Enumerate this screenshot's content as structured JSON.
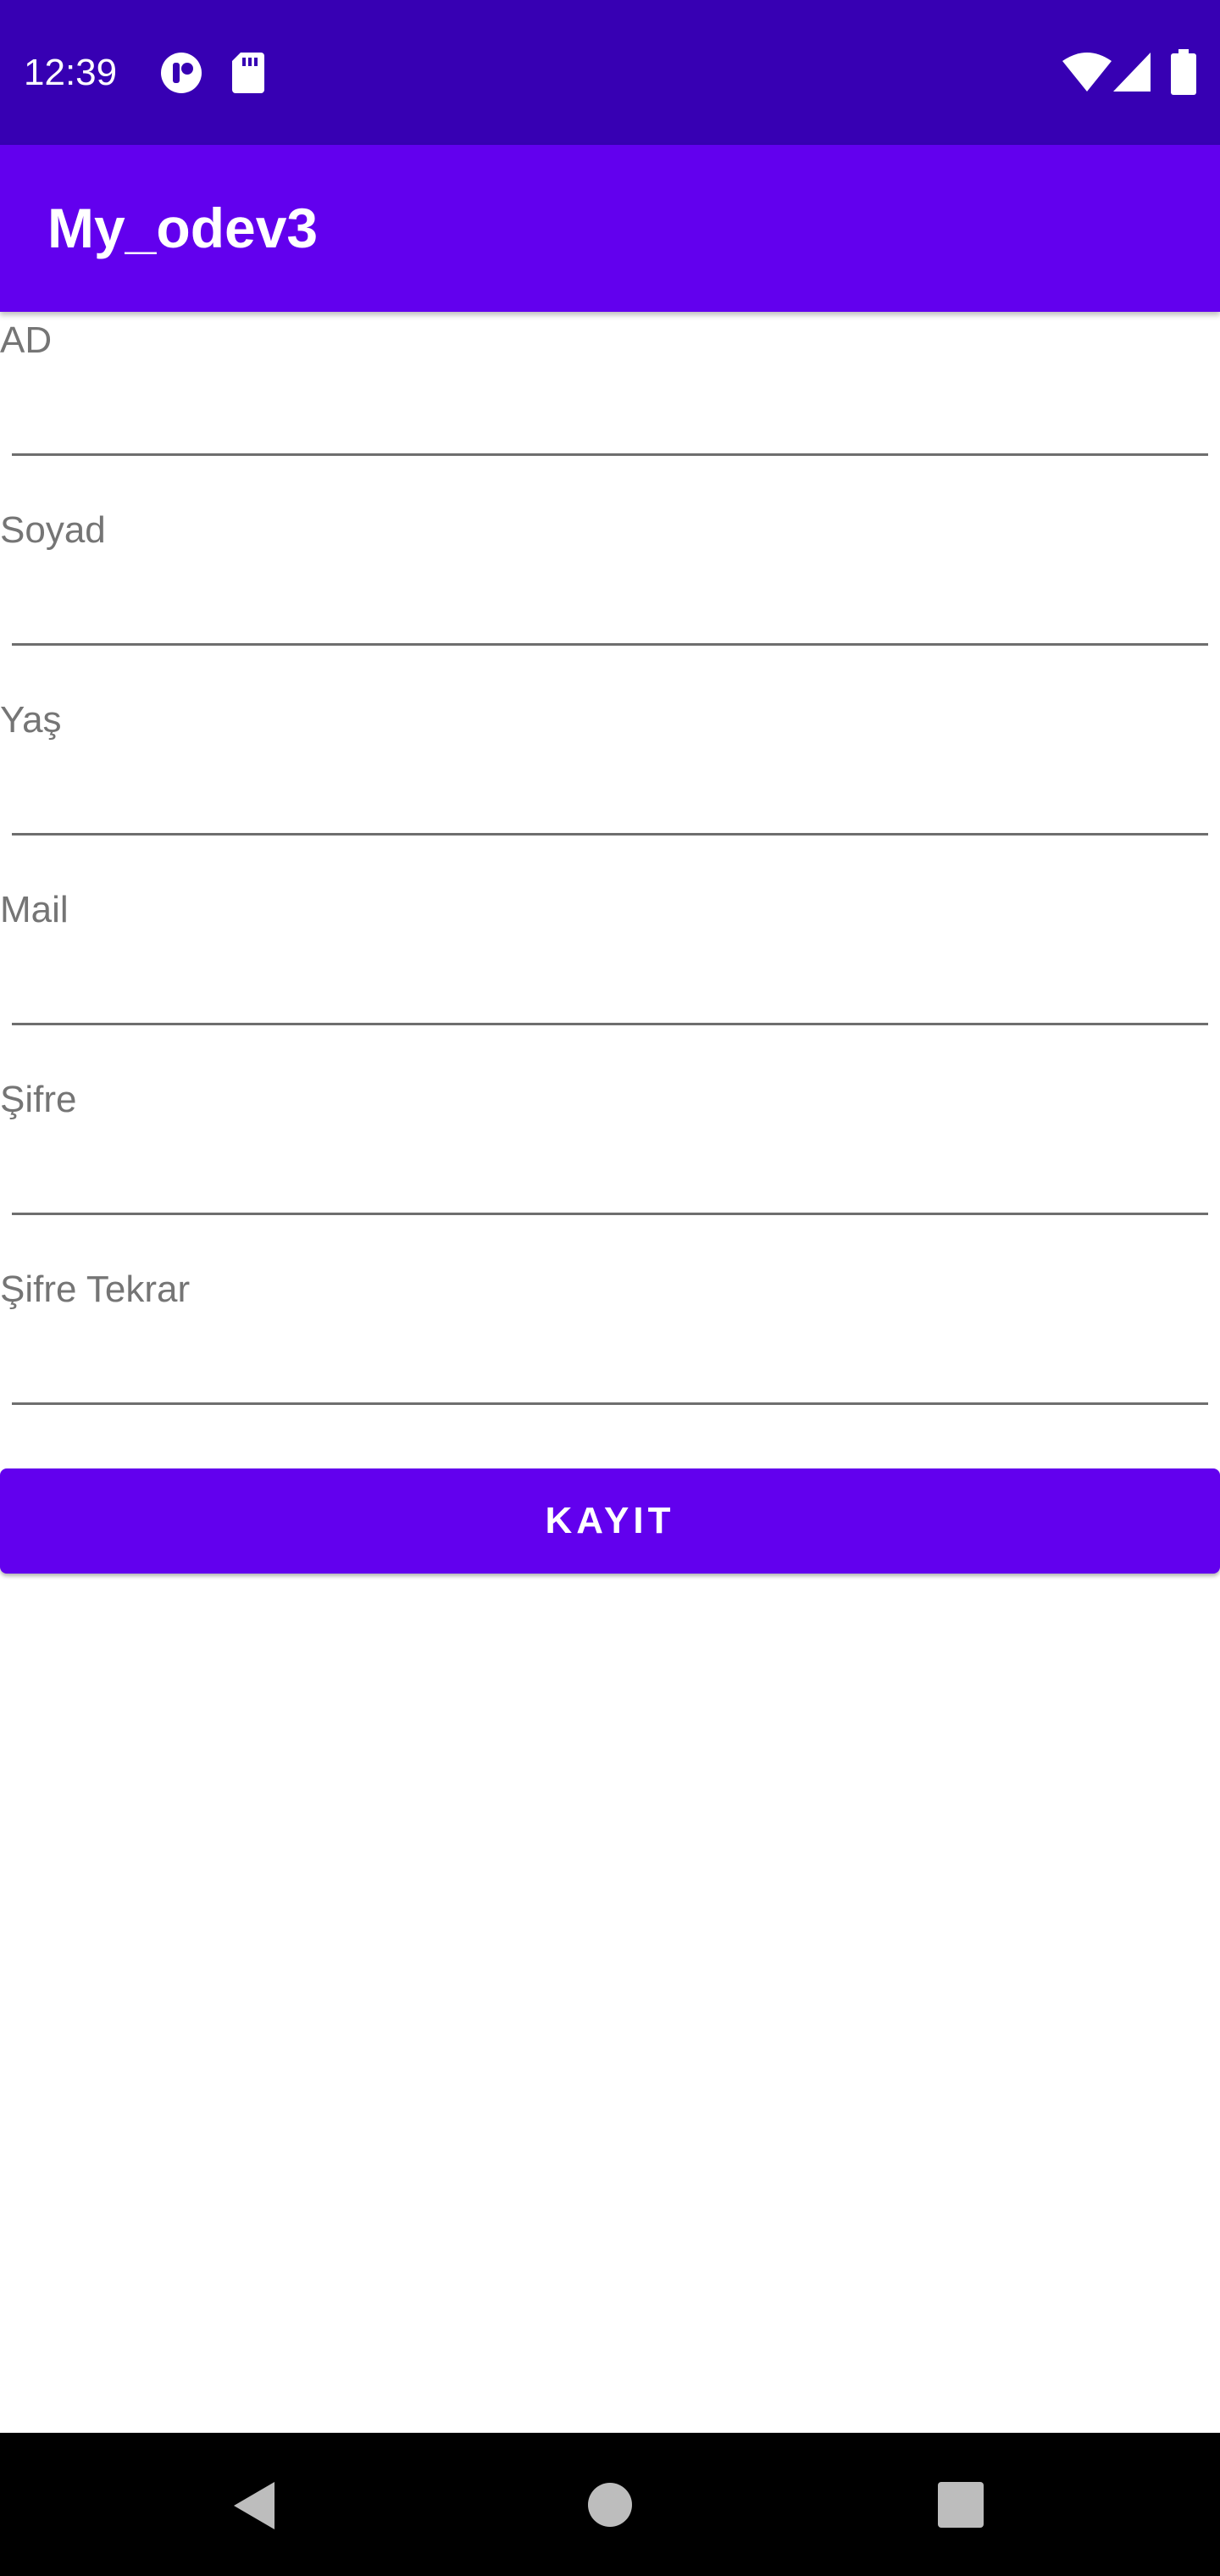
{
  "status_bar": {
    "time": "12:39",
    "icons": [
      "notification-icon",
      "sd-card-icon",
      "wifi-icon",
      "signal-icon",
      "battery-icon"
    ],
    "background": "#3700b3"
  },
  "app_bar": {
    "title": "My_odev3",
    "background": "#6200ee"
  },
  "form": {
    "fields": [
      {
        "label": "AD",
        "value": ""
      },
      {
        "label": "Soyad",
        "value": ""
      },
      {
        "label": "Yaş",
        "value": ""
      },
      {
        "label": "Mail",
        "value": ""
      },
      {
        "label": "Şifre",
        "value": ""
      },
      {
        "label": "Şifre Tekrar",
        "value": ""
      }
    ],
    "submit_label": "KAYIT",
    "accent": "#6200ee"
  },
  "nav_bar": {
    "icons": [
      "back-icon",
      "home-icon",
      "recents-icon"
    ]
  }
}
